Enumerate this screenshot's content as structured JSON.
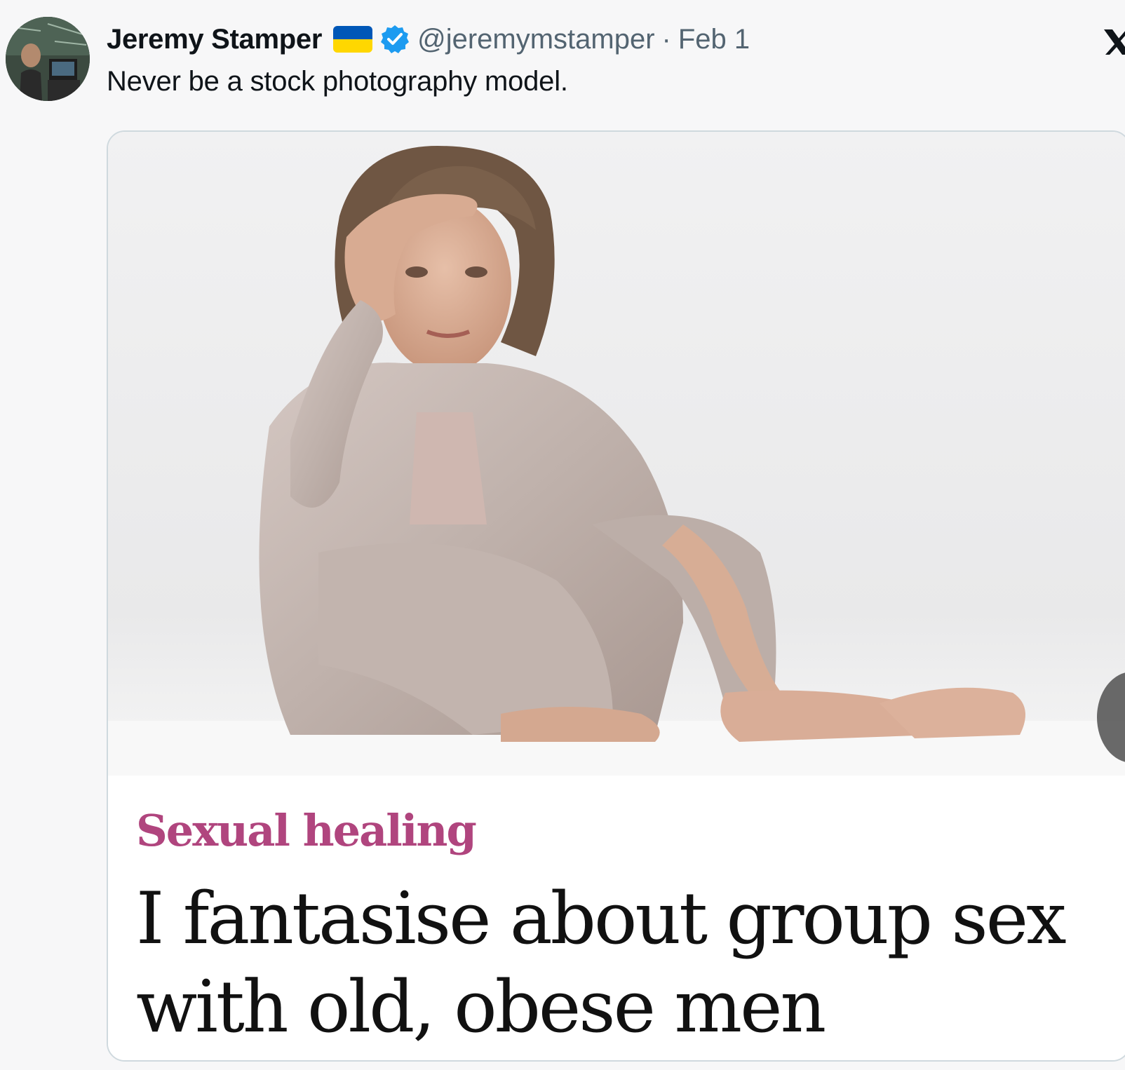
{
  "tweet": {
    "display_name": "Jeremy Stamper",
    "handle": "@jeremymstamper",
    "separator": "·",
    "date": "Feb 1",
    "text": "Never be a stock photography model."
  },
  "icons": {
    "avatar": "avatar-photo",
    "flag": "ukraine-flag-icon",
    "verified": "verified-badge-icon",
    "close": "x-logo-icon",
    "nav": "next-arrow-icon"
  },
  "media": {
    "kicker": "Sexual healing",
    "headline_line1": "I fantasise about group sex",
    "headline_line2": "with old, obese men"
  },
  "colors": {
    "kicker": "#b0457e",
    "verified": "#1d9bf0",
    "flag_blue": "#0057b7",
    "flag_yellow": "#ffd700"
  }
}
